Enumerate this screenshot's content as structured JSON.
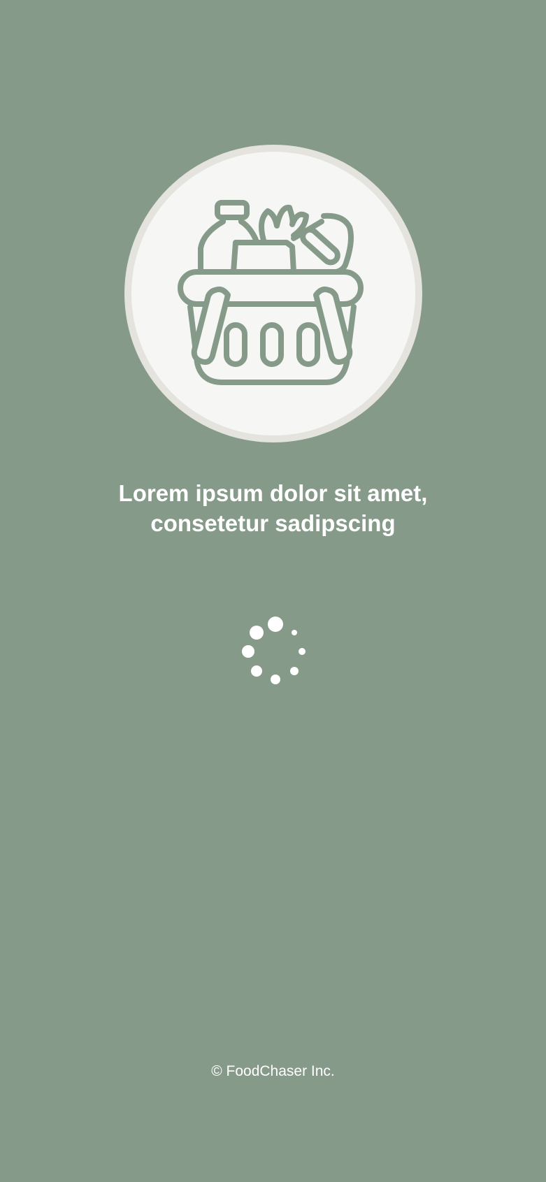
{
  "splash": {
    "headline_line1": "Lorem ipsum dolor sit amet,",
    "headline_line2": "consetetur sadipscing",
    "copyright": "© FoodChaser Inc."
  },
  "logo": {
    "icon": "grocery-basket-icon"
  },
  "loading": {
    "icon": "loading-spinner-icon"
  },
  "colors": {
    "background": "#859A89",
    "logo_ring": "#E4E3DD",
    "logo_fill": "#F6F6F4",
    "icon_stroke": "#859A89",
    "text": "#FFFFFF"
  }
}
